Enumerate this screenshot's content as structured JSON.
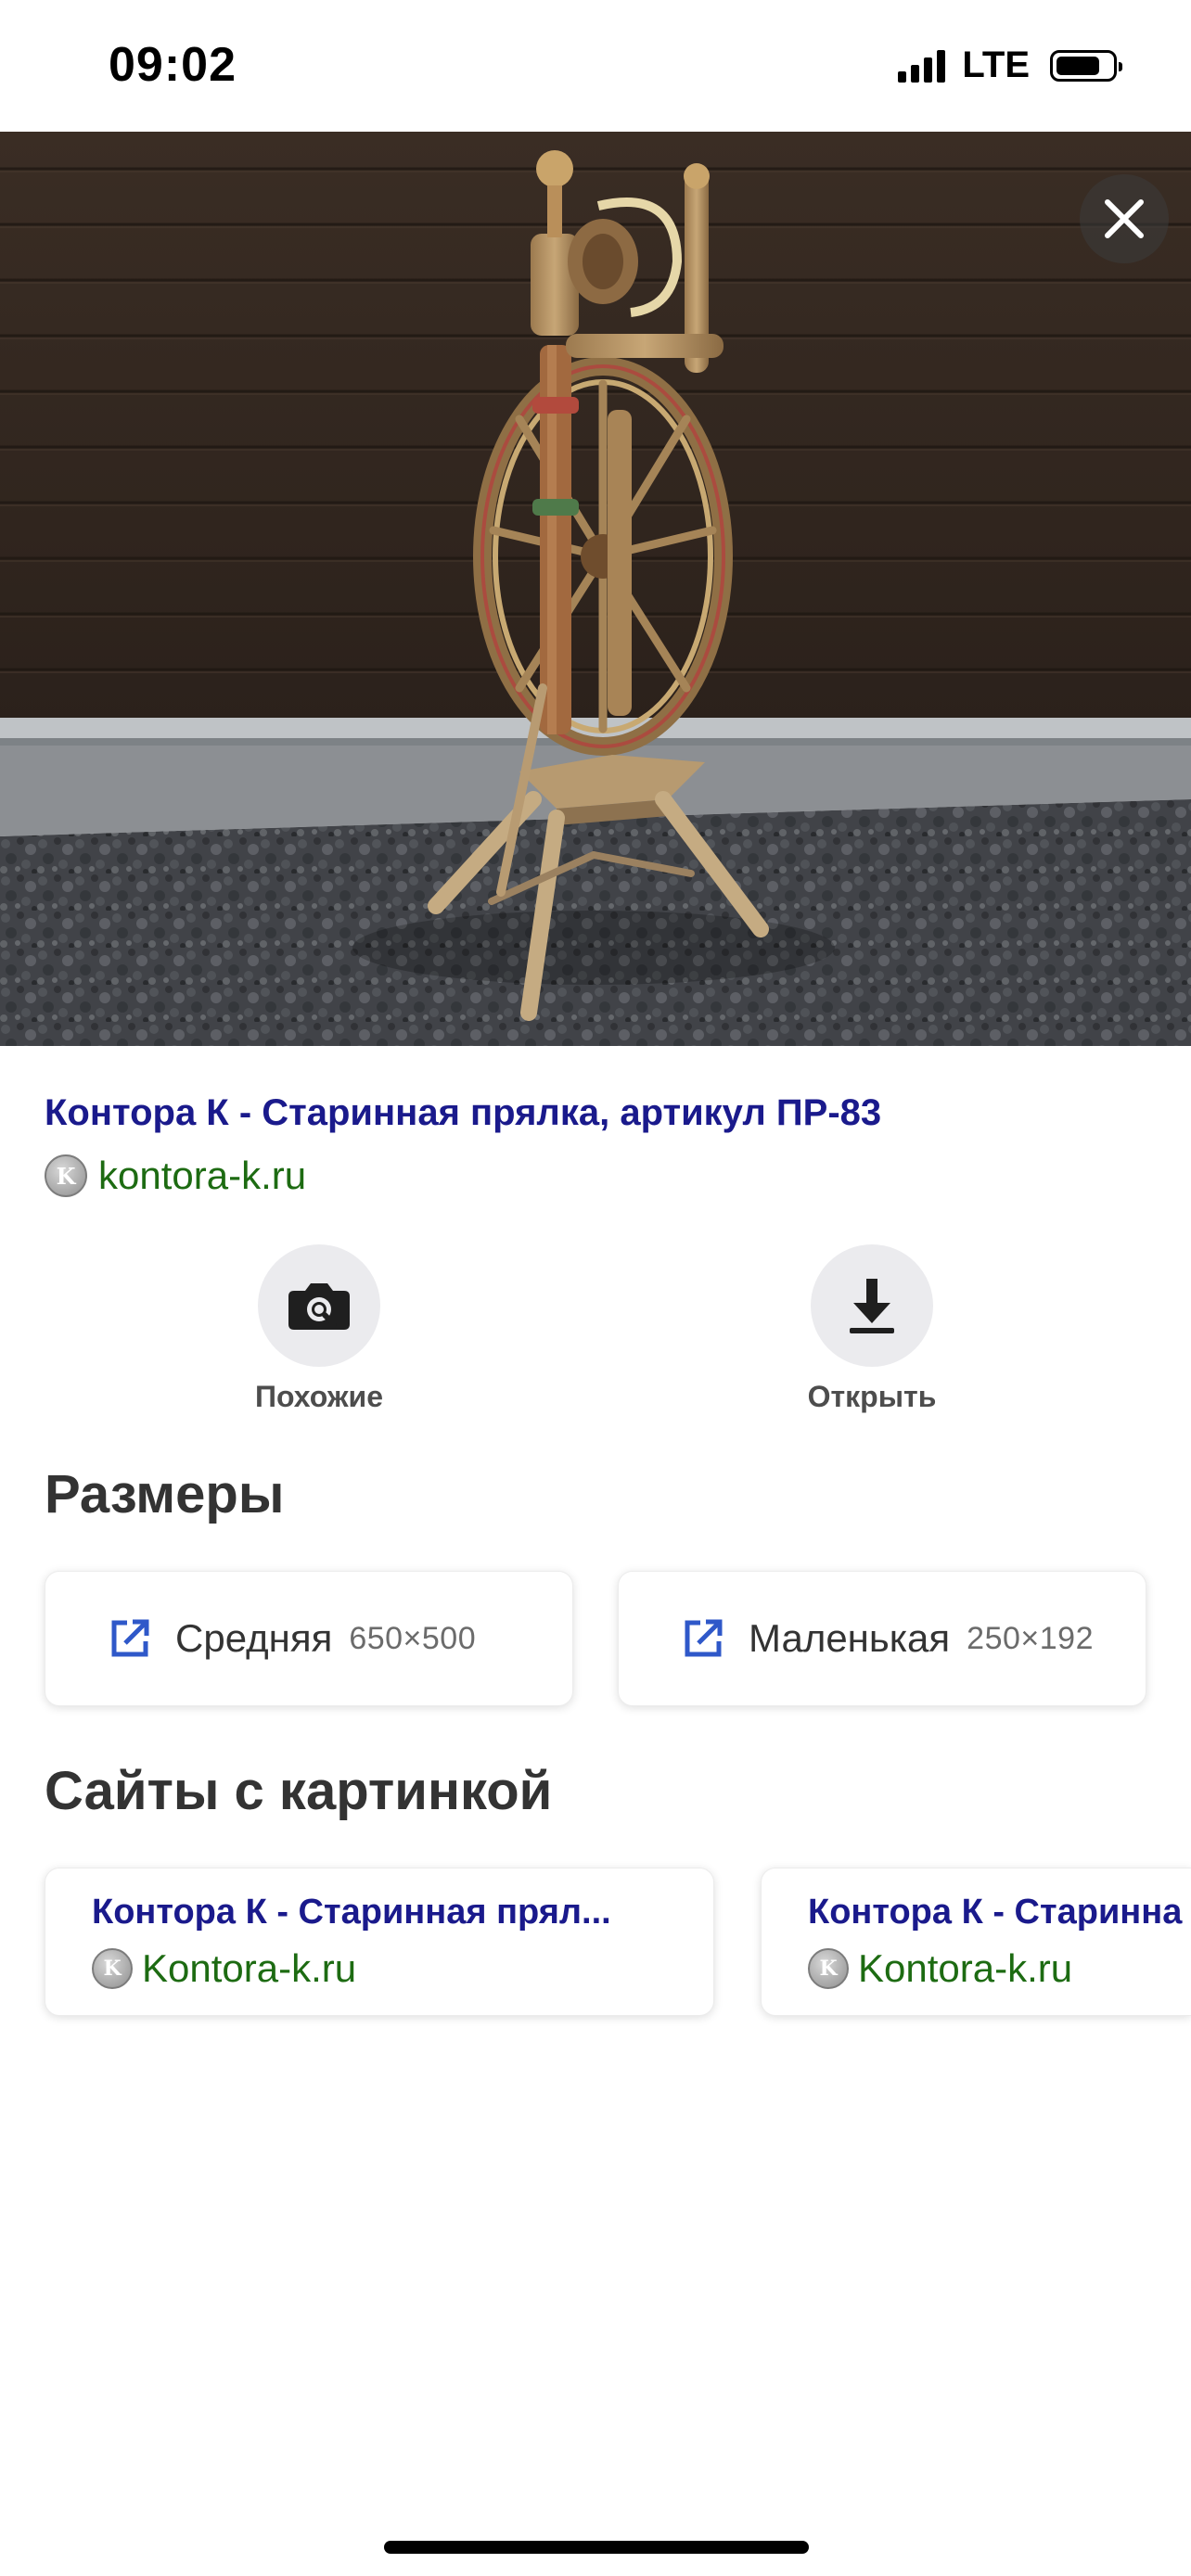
{
  "status_bar": {
    "time": "09:02",
    "network": "LTE",
    "battery_level": 0.8,
    "signal_bars": 4
  },
  "result": {
    "title": "Контора К - Старинная прялка, артикул ПР-83",
    "source": "kontora-k.ru",
    "favicon_letter": "K"
  },
  "actions": [
    {
      "label": "Похожие",
      "icon": "camera-search-icon"
    },
    {
      "label": "Открыть",
      "icon": "download-icon"
    }
  ],
  "sizes_section": {
    "title": "Размеры",
    "items": [
      {
        "name": "Средняя",
        "dims": "650×500",
        "icon": "external-link-icon"
      },
      {
        "name": "Маленькая",
        "dims": "250×192",
        "icon": "external-link-icon"
      }
    ]
  },
  "sites_section": {
    "title": "Сайты с картинкой",
    "items": [
      {
        "title": "Контора К - Старинная прял...",
        "source": "Kontora-k.ru"
      },
      {
        "title": "Контора К - Старинна",
        "source": "Kontora-k.ru"
      }
    ]
  },
  "colors": {
    "link_title": "#1a1a8c",
    "link_source": "#1d6b12",
    "accent_icon": "#2f58c9",
    "section_title": "#333333"
  }
}
